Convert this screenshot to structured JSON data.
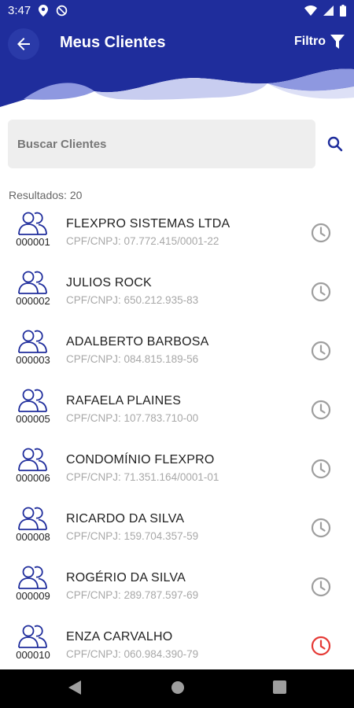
{
  "status_bar": {
    "time": "3:47",
    "icons": [
      "location-icon",
      "sync-disabled-icon",
      "wifi-icon",
      "signal-icon",
      "battery-icon"
    ]
  },
  "header": {
    "title": "Meus Clientes",
    "filter_label": "Filtro",
    "back_icon": "arrow-left-icon",
    "filter_icon": "funnel-icon",
    "colors": {
      "primary": "#1f2d9c",
      "wave_light": "#c8cdf0",
      "wave_mid": "#8e98e0"
    }
  },
  "search": {
    "placeholder": "Buscar Clientes",
    "value": "",
    "icon": "search-icon"
  },
  "results": {
    "label": "Resultados: 20"
  },
  "clients": [
    {
      "code": "000001",
      "name": "FLEXPRO SISTEMAS LTDA",
      "doc": "CPF/CNPJ: 07.772.415/0001-22",
      "clock_color": "#9e9e9e"
    },
    {
      "code": "000002",
      "name": "JULIOS ROCK",
      "doc": "CPF/CNPJ: 650.212.935-83",
      "clock_color": "#9e9e9e"
    },
    {
      "code": "000003",
      "name": "ADALBERTO BARBOSA",
      "doc": "CPF/CNPJ: 084.815.189-56",
      "clock_color": "#9e9e9e"
    },
    {
      "code": "000005",
      "name": "RAFAELA PLAINES",
      "doc": "CPF/CNPJ: 107.783.710-00",
      "clock_color": "#9e9e9e"
    },
    {
      "code": "000006",
      "name": "CONDOMÍNIO FLEXPRO",
      "doc": "CPF/CNPJ: 71.351.164/0001-01",
      "clock_color": "#9e9e9e"
    },
    {
      "code": "000008",
      "name": "RICARDO DA SILVA",
      "doc": "CPF/CNPJ: 159.704.357-59",
      "clock_color": "#9e9e9e"
    },
    {
      "code": "000009",
      "name": "ROGÉRIO DA SILVA",
      "doc": "CPF/CNPJ: 289.787.597-69",
      "clock_color": "#9e9e9e"
    },
    {
      "code": "000010",
      "name": "ENZA CARVALHO",
      "doc": "CPF/CNPJ: 060.984.390-79",
      "clock_color": "#e53935"
    }
  ],
  "nav_bar": {
    "icons": [
      "back-triangle-icon",
      "home-circle-icon",
      "recents-square-icon"
    ]
  }
}
